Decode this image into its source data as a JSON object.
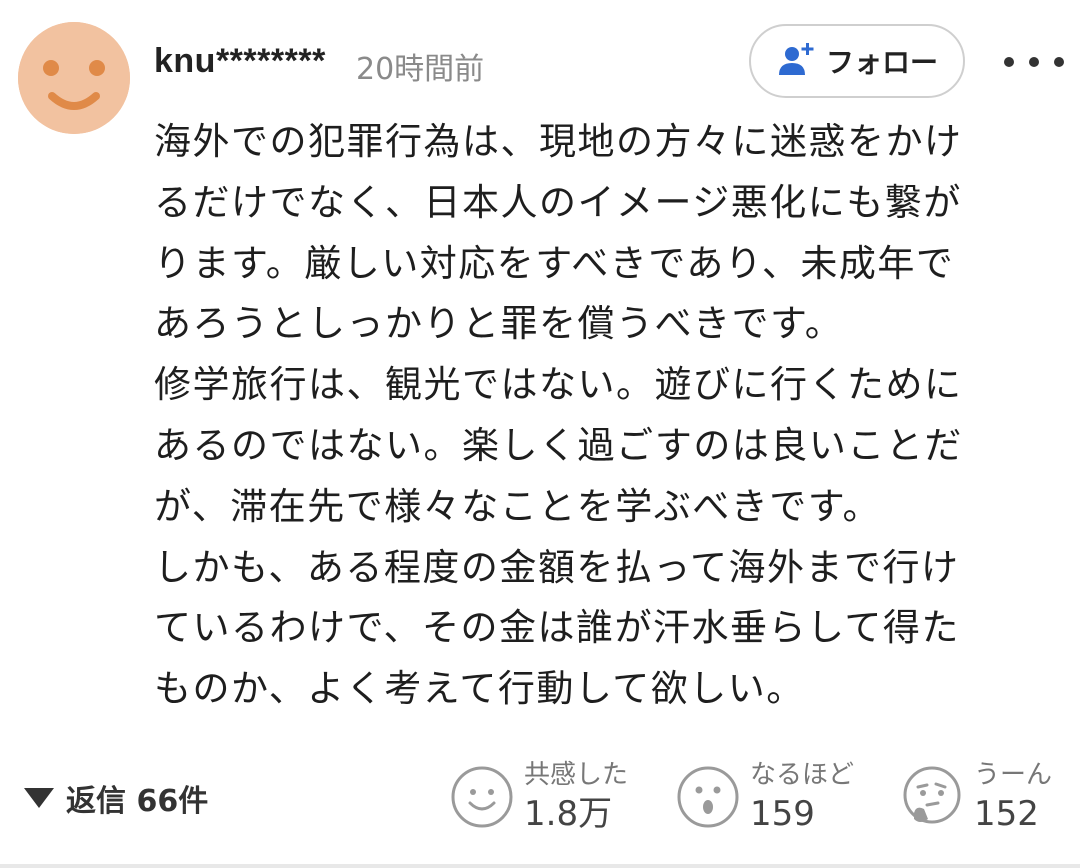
{
  "header": {
    "username": "knu********",
    "timestamp": "20時間前",
    "follow_label": "フォロー",
    "avatar_color": "#f2c2a0",
    "accent_color": "#2e6ad1"
  },
  "comment": {
    "lines": [
      "海外での犯罪行為は、現地の方々に迷惑をかけ",
      "るだけでなく、日本人のイメージ悪化にも繋が",
      "ります。厳しい対応をすべきであり、未成年で",
      "あろうとしっかりと罪を償うべきです。",
      "修学旅行は、観光ではない。遊びに行くために",
      "あるのではない。楽しく過ごすのは良いことだ",
      "が、滞在先で様々なことを学ぶべきです。",
      "しかも、ある程度の金額を払って海外まで行け",
      "ているわけで、その金は誰が汗水垂らして得た",
      "ものか、よく考えて行動して欲しい。"
    ]
  },
  "footer": {
    "replies_label": "返信 66件",
    "reactions": [
      {
        "label": "共感した",
        "count": "1.8万",
        "icon": "smile-face-icon"
      },
      {
        "label": "なるほど",
        "count": "159",
        "icon": "surprised-face-icon"
      },
      {
        "label": "うーん",
        "count": "152",
        "icon": "thinking-face-icon"
      }
    ]
  }
}
